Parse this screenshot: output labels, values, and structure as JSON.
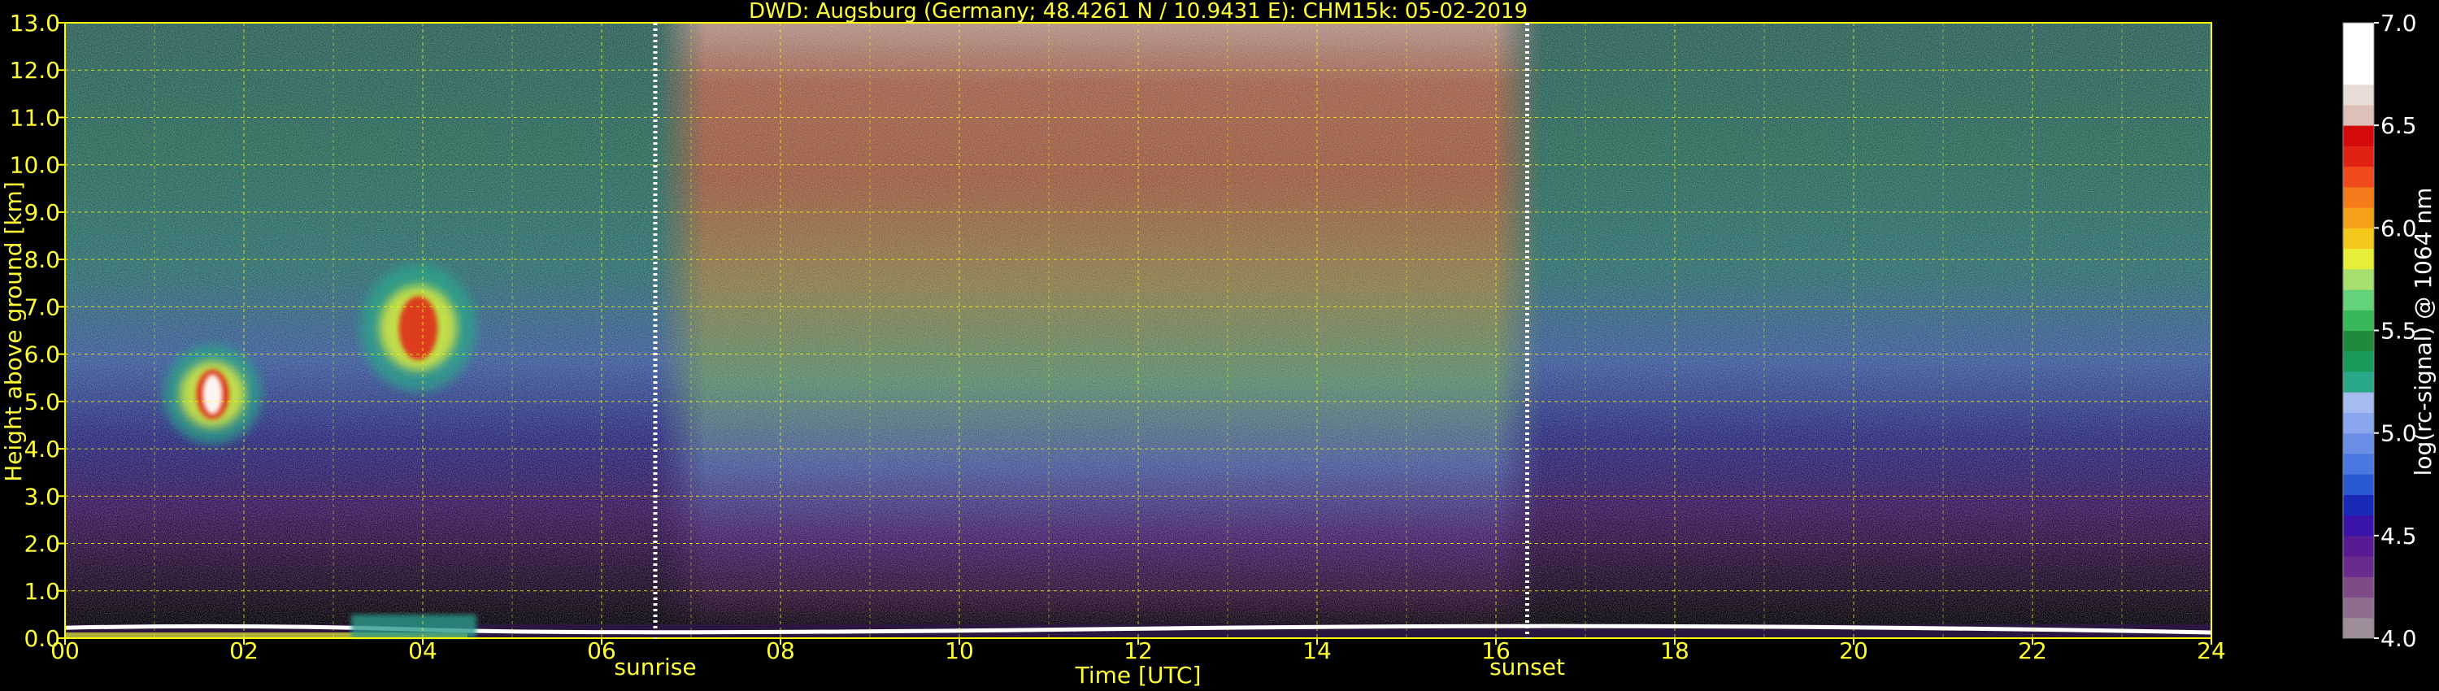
{
  "title": "DWD: Augsburg (Germany; 48.4261 N / 10.9431 E):    CHM15k: 05-02-2019",
  "chart_data": {
    "type": "heatmap",
    "title": "DWD: Augsburg (Germany; 48.4261 N / 10.9431 E):    CHM15k: 05-02-2019",
    "xlabel": "Time [UTC]",
    "ylabel": "Height above ground [km]",
    "xlim": [
      0,
      24
    ],
    "ylim": [
      0,
      13
    ],
    "xticks": [
      "00",
      "02",
      "04",
      "06",
      "08",
      "10",
      "12",
      "14",
      "16",
      "18",
      "20",
      "22",
      "24"
    ],
    "xtick_values": [
      0,
      2,
      4,
      6,
      8,
      10,
      12,
      14,
      16,
      18,
      20,
      22,
      24
    ],
    "yticks": [
      "0.0",
      "1.0",
      "2.0",
      "3.0",
      "4.0",
      "5.0",
      "6.0",
      "7.0",
      "8.0",
      "9.0",
      "10.0",
      "11.0",
      "12.0",
      "13.0"
    ],
    "ytick_values": [
      0,
      1,
      2,
      3,
      4,
      5,
      6,
      7,
      8,
      9,
      10,
      11,
      12,
      13
    ],
    "grid": true,
    "grid_color": "#ffff00",
    "markers": [
      {
        "label": "sunrise",
        "time": 6.6
      },
      {
        "label": "sunset",
        "time": 16.35
      }
    ],
    "colorbar": {
      "label": "log(rc-signal) @ 1064 nm",
      "range": [
        4.0,
        7.0
      ],
      "ticks": [
        "4.0",
        "4.5",
        "5.0",
        "5.5",
        "6.0",
        "6.5",
        "7.0"
      ],
      "tick_values": [
        4.0,
        4.5,
        5.0,
        5.5,
        6.0,
        6.5,
        7.0
      ],
      "colors": [
        "#9e8e99",
        "#8e6d8e",
        "#7e4b88",
        "#6a2c8c",
        "#5a1a94",
        "#3a14a8",
        "#1a2ab8",
        "#2a5ad0",
        "#4a78e0",
        "#6a8ee6",
        "#8aa6ee",
        "#a6bcf0",
        "#2aa88a",
        "#1a9a5a",
        "#1e8a3a",
        "#36b85a",
        "#64d27a",
        "#a8e070",
        "#e6ee3a",
        "#f4c81a",
        "#f4a018",
        "#f47a1a",
        "#f04a1a",
        "#e02212",
        "#d40a0a",
        "#dcc0b8",
        "#e8ddd6",
        "#ffffff",
        "#ffffff",
        "#ffffff"
      ]
    },
    "features": [
      {
        "name": "cloud layer",
        "t_start": 1.1,
        "t_end": 2.2,
        "z_bottom": 4.1,
        "z_top": 6.2,
        "peak": 6.8
      },
      {
        "name": "cloud layer",
        "t_start": 3.3,
        "t_end": 4.6,
        "z_bottom": 5.2,
        "z_top": 7.9,
        "peak": 6.2
      },
      {
        "name": "daytime background",
        "t_start": 7.0,
        "t_end": 16.0,
        "z_bottom": 0.5,
        "z_top": 13.0,
        "peak": 6.0
      },
      {
        "name": "surface layer",
        "t_start": 0.0,
        "t_end": 24.0,
        "z_bottom": 0.0,
        "z_top": 0.3,
        "peak": 7.0
      }
    ]
  }
}
